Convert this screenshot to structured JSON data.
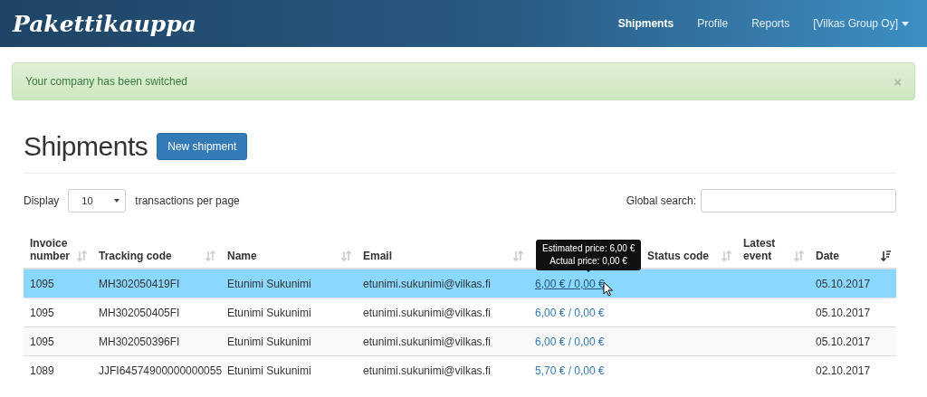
{
  "navbar": {
    "brand": "Pakettikauppa",
    "items": [
      {
        "label": "Shipments",
        "selected": true
      },
      {
        "label": "Profile",
        "selected": false
      },
      {
        "label": "Reports",
        "selected": false
      }
    ],
    "company": "[Vilkas Group Oy]"
  },
  "alert": {
    "message": "Your company has been switched",
    "close": "×"
  },
  "page": {
    "title": "Shipments",
    "new_button": "New shipment"
  },
  "controls": {
    "display_label": "Display",
    "page_size": "10",
    "per_page_label": "transactions per page",
    "search_label": "Global search:"
  },
  "table": {
    "columns": [
      {
        "label": "Invoice number",
        "sorted": false
      },
      {
        "label": "Tracking code",
        "sorted": false
      },
      {
        "label": "Name",
        "sorted": false
      },
      {
        "label": "Email",
        "sorted": false
      },
      {},
      {
        "label": "Status code",
        "sorted": false
      },
      {
        "label": "Latest event",
        "sorted": false
      },
      {
        "label": "Date",
        "sorted": true
      }
    ],
    "tooltip": [
      "Estimated price: 6,00 €",
      "Actual price: 0,00 €"
    ],
    "rows": [
      {
        "selected": true,
        "cells": [
          "1095",
          "MH302050419FI",
          "Etunimi Sukunimi",
          "etunimi.sukunimi@vilkas.fi",
          "6,00 € / 0,00 €",
          "",
          "",
          "05.10.2017"
        ]
      },
      {
        "selected": false,
        "cells": [
          "1095",
          "MH302050405FI",
          "Etunimi Sukunimi",
          "etunimi.sukunimi@vilkas.fi",
          "6,00 € / 0,00 €",
          "",
          "",
          "05.10.2017"
        ]
      },
      {
        "selected": false,
        "cells": [
          "1095",
          "MH302050396FI",
          "Etunimi Sukunimi",
          "etunimi.sukunimi@vilkas.fi",
          "6,00 € / 0,00 €",
          "",
          "",
          "05.10.2017"
        ]
      },
      {
        "selected": false,
        "cells": [
          "1089",
          "JJFI64574900000000055",
          "Etunimi Sukunimi",
          "etunimi.sukunimi@vilkas.fi",
          "5,70 € / 0,00 €",
          "",
          "",
          "02.10.2017"
        ]
      }
    ]
  }
}
